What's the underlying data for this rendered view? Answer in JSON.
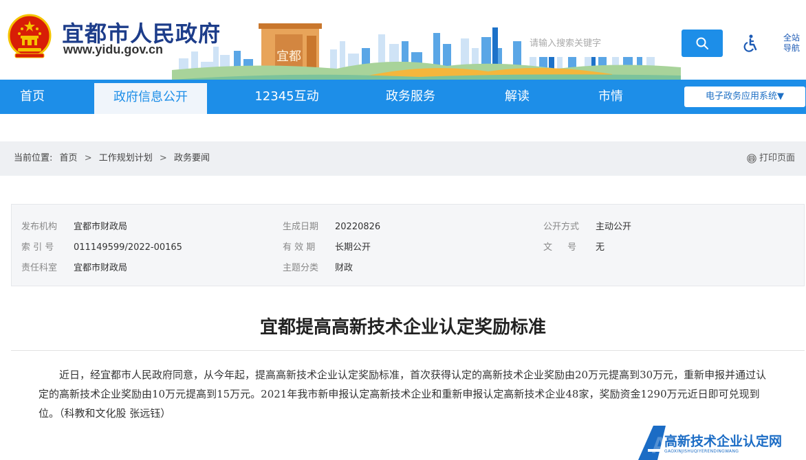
{
  "header": {
    "site_title": "宜都市人民政府",
    "site_url": "www.yidu.gov.cn",
    "skyline_sign": "宜都",
    "search_placeholder": "请输入搜索关键字",
    "site_nav_label": "全站导航"
  },
  "nav": {
    "items": [
      {
        "label": "首页"
      },
      {
        "label": "政府信息公开",
        "active": true
      },
      {
        "label": "12345互动"
      },
      {
        "label": "政务服务"
      },
      {
        "label": "解读"
      },
      {
        "label": "市情"
      }
    ],
    "apps_label": "电子政务应用系统▼"
  },
  "breadcrumb": {
    "prefix": "当前位置:",
    "items": [
      "首页",
      "工作规划计划",
      "政务要闻"
    ],
    "separator": ">",
    "print_label": "打印页面"
  },
  "meta": {
    "publisher_label": "发布机构",
    "publisher": "宜都市财政局",
    "gen_date_label": "生成日期",
    "gen_date": "20220826",
    "open_method_label": "公开方式",
    "open_method": "主动公开",
    "index_label": "索 引 号",
    "index": "011149599/2022-00165",
    "validity_label": "有 效 期",
    "validity": "长期公开",
    "doc_no_label": "文 号",
    "doc_no": "无",
    "office_label": "责任科室",
    "office": "宜都市财政局",
    "topic_label": "主题分类",
    "topic": "财政"
  },
  "article": {
    "title": "宜都提高高新技术企业认定奖励标准",
    "body": "近日，经宜都市人民政府同意，从今年起，提高高新技术企业认定奖励标准，首次获得认定的高新技术企业奖励由20万元提高到30万元，重新申报并通过认定的高新技术企业奖励由10万元提高到15万元。2021年我市新申报认定高新技术企业和重新申报认定高新技术企业48家，奖励资金1290万元近日即可兑现到位。（科教和文化股 张远钰）"
  },
  "watermark": {
    "logo_letter": "A",
    "text": "高新技术企业认定网",
    "sub": "GAOXINJISHUQIYERENDINGWANG"
  },
  "colors": {
    "primary": "#1d8ee8",
    "title_blue": "#1d3d8a",
    "crumb_bg": "#eef0f3",
    "meta_bg": "#f5f6f8"
  },
  "icons": {
    "emblem": "national-emblem-icon",
    "search": "search-icon",
    "accessibility": "accessibility-icon",
    "print": "printer-icon"
  }
}
